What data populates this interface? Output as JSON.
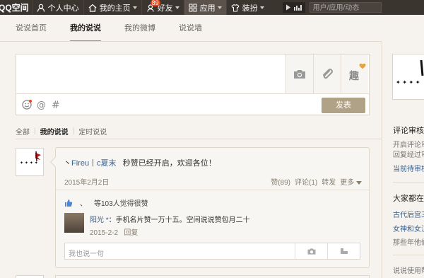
{
  "topbar": {
    "logo": "QQ空间",
    "personal_center": "个人中心",
    "my_home": "我的主页",
    "friends": "好友",
    "friends_badge": "89",
    "apps": "应用",
    "dress_up": "装扮",
    "search_placeholder": "用户/应用/动态"
  },
  "tabs": [
    "说说首页",
    "我的说说",
    "我的微博",
    "说说墙"
  ],
  "composer": {
    "send_label": "发表",
    "fun_label": "趣"
  },
  "filter": [
    "全部",
    "我的说说",
    "定时说说"
  ],
  "post": {
    "author": "Fireu丨c夏末",
    "content": "秒赞已经开启，欢迎各位！",
    "date": "2015年2月2日",
    "likes_label": "赞(89)",
    "comments_label": "评论(1)",
    "forward_label": "转发",
    "more_label": "更多",
    "likes_summary": "等103人觉得很赞",
    "comment": {
      "name": "阳光 *",
      "text": "：手机名片赞一万十五。空间说说赞包月二十",
      "date": "2015-2-2",
      "reply_label": "回复"
    },
    "reply_placeholder": "我也说一句"
  },
  "sidebar": {
    "sec1_title": "评论审核",
    "sec1_items": [
      "开启评论审",
      "回复经过审",
      "当前待审核"
    ],
    "sec2_title": "大家都在",
    "sec2_items": [
      "古代后宫三",
      "女神和女汉",
      "那些年他们"
    ],
    "sec3_title": "说说使用帮"
  },
  "colors": {
    "topbar_bg": "#3b3530",
    "accent": "#b0a286",
    "link": "#3a5f8a",
    "badge": "#e8431a"
  }
}
